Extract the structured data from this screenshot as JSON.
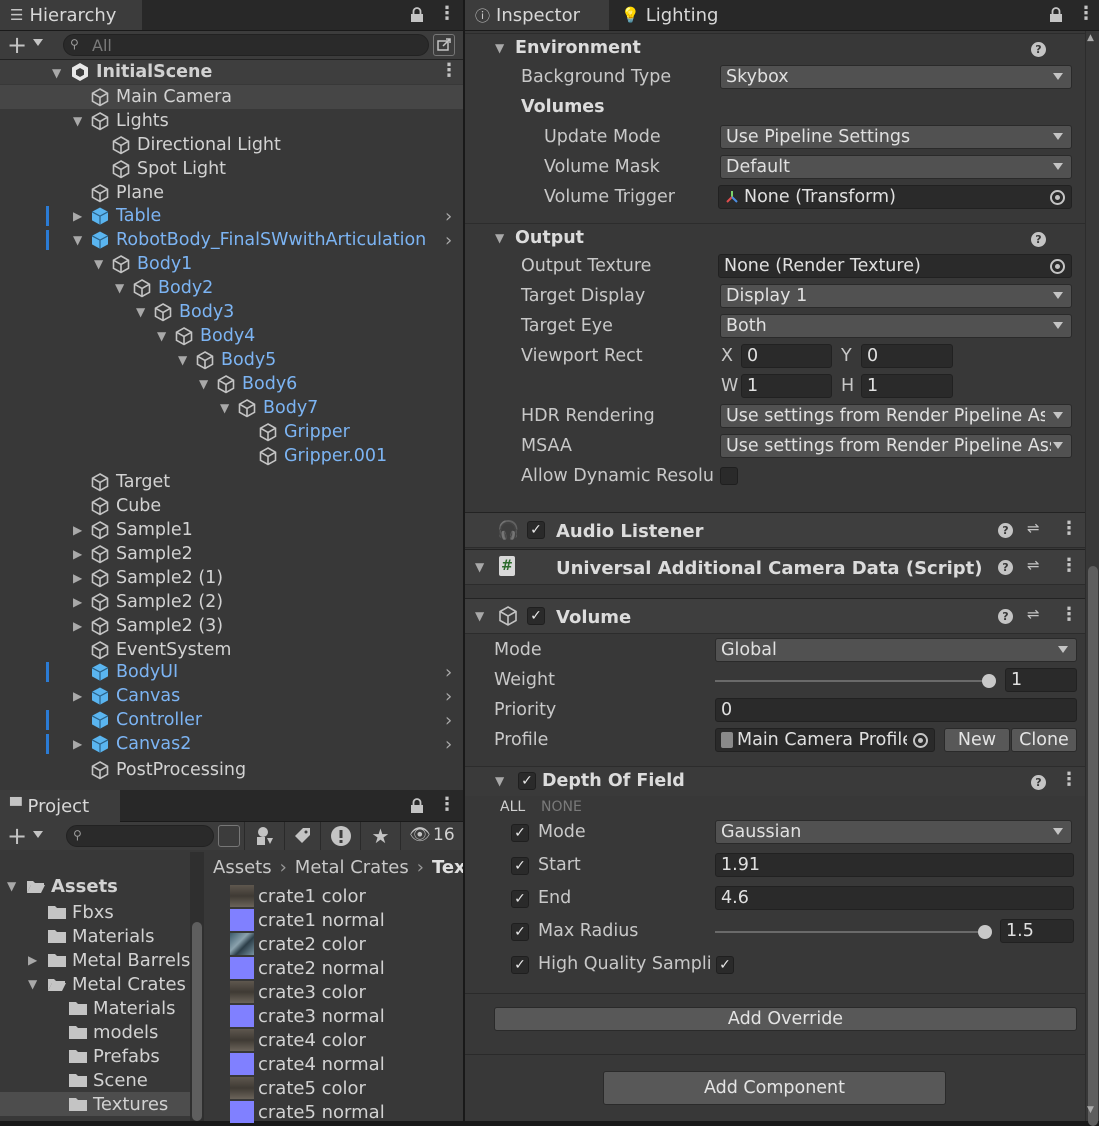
{
  "hierarchy": {
    "tab": "Hierarchy",
    "search_placeholder": "All",
    "scene": "InitialScene",
    "items": [
      {
        "label": "Main Camera"
      },
      {
        "label": "Lights"
      },
      {
        "label": "Directional Light"
      },
      {
        "label": "Spot Light"
      },
      {
        "label": "Plane"
      },
      {
        "label": "Table"
      },
      {
        "label": "RobotBody_FinalSWwithArticulation"
      },
      {
        "label": "Body1"
      },
      {
        "label": "Body2"
      },
      {
        "label": "Body3"
      },
      {
        "label": "Body4"
      },
      {
        "label": "Body5"
      },
      {
        "label": "Body6"
      },
      {
        "label": "Body7"
      },
      {
        "label": "Gripper"
      },
      {
        "label": "Gripper.001"
      },
      {
        "label": "Target"
      },
      {
        "label": "Cube"
      },
      {
        "label": "Sample1"
      },
      {
        "label": "Sample2"
      },
      {
        "label": "Sample2 (1)"
      },
      {
        "label": "Sample2 (2)"
      },
      {
        "label": "Sample2 (3)"
      },
      {
        "label": "EventSystem"
      },
      {
        "label": "BodyUI"
      },
      {
        "label": "Canvas"
      },
      {
        "label": "Controller"
      },
      {
        "label": "Canvas2"
      },
      {
        "label": "PostProcessing"
      }
    ]
  },
  "project": {
    "tab": "Project",
    "hidden_count": "16",
    "folders": [
      {
        "label": "Assets"
      },
      {
        "label": "Fbxs"
      },
      {
        "label": "Materials"
      },
      {
        "label": "Metal Barrels"
      },
      {
        "label": "Metal Crates"
      },
      {
        "label": "Materials"
      },
      {
        "label": "models"
      },
      {
        "label": "Prefabs"
      },
      {
        "label": "Scene"
      },
      {
        "label": "Textures"
      }
    ],
    "breadcrumb": [
      "Assets",
      "Metal Crates",
      "Tex"
    ],
    "files": [
      {
        "label": "crate1 color",
        "kind": "color"
      },
      {
        "label": "crate1 normal",
        "kind": "normal"
      },
      {
        "label": "crate2 color",
        "kind": "color2"
      },
      {
        "label": "crate2 normal",
        "kind": "normal"
      },
      {
        "label": "crate3 color",
        "kind": "color"
      },
      {
        "label": "crate3 normal",
        "kind": "normal"
      },
      {
        "label": "crate4 color",
        "kind": "color"
      },
      {
        "label": "crate4 normal",
        "kind": "normal"
      },
      {
        "label": "crate5 color",
        "kind": "color"
      },
      {
        "label": "crate5 normal",
        "kind": "normal"
      }
    ]
  },
  "inspector": {
    "tabs": [
      "Inspector",
      "Lighting"
    ],
    "environment": {
      "title": "Environment",
      "background_type_label": "Background Type",
      "background_type": "Skybox",
      "volumes_label": "Volumes",
      "update_mode_label": "Update Mode",
      "update_mode": "Use Pipeline Settings",
      "volume_mask_label": "Volume Mask",
      "volume_mask": "Default",
      "volume_trigger_label": "Volume Trigger",
      "volume_trigger": "None (Transform)"
    },
    "output": {
      "title": "Output",
      "output_texture_label": "Output Texture",
      "output_texture": "None (Render Texture)",
      "target_display_label": "Target Display",
      "target_display": "Display 1",
      "target_eye_label": "Target Eye",
      "target_eye": "Both",
      "viewport_label": "Viewport Rect",
      "x_label": "X",
      "x": "0",
      "y_label": "Y",
      "y": "0",
      "w_label": "W",
      "w": "1",
      "h_label": "H",
      "h": "1",
      "hdr_label": "HDR Rendering",
      "hdr": "Use settings from Render Pipeline Asset",
      "msaa_label": "MSAA",
      "msaa": "Use settings from Render Pipeline Asset",
      "dynres_label": "Allow Dynamic Resolu"
    },
    "audio_listener": "Audio Listener",
    "camera_data": "Universal Additional Camera Data (Script)",
    "volume": {
      "title": "Volume",
      "mode_label": "Mode",
      "mode": "Global",
      "weight_label": "Weight",
      "weight": "1",
      "weight_fraction": 1,
      "priority_label": "Priority",
      "priority": "0",
      "profile_label": "Profile",
      "profile": "Main Camera Profile",
      "new_label": "New",
      "clone_label": "Clone"
    },
    "dof": {
      "title": "Depth Of Field",
      "all": "ALL",
      "none": "NONE",
      "mode_label": "Mode",
      "mode": "Gaussian",
      "start_label": "Start",
      "start": "1.91",
      "end_label": "End",
      "end": "4.6",
      "maxr_label": "Max Radius",
      "maxr": "1.5",
      "maxr_fraction": 1,
      "hq_label": "High Quality Sampli"
    },
    "add_override": "Add Override",
    "add_component": "Add Component"
  }
}
